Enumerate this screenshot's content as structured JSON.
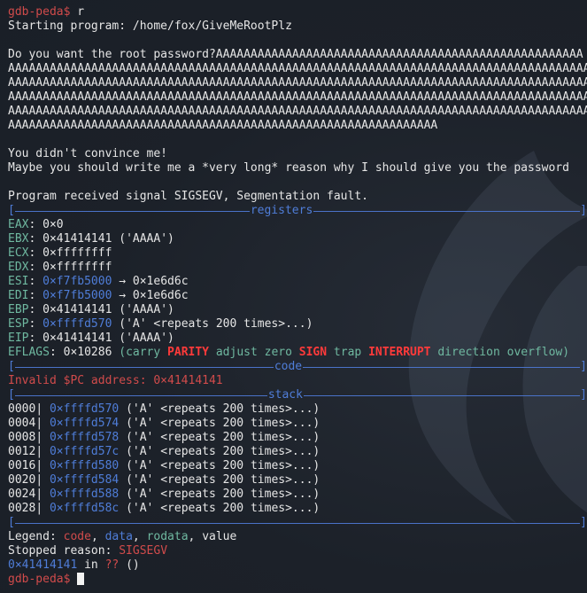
{
  "prompt": "gdb-peda$ ",
  "command": "r",
  "starting": "Starting program: /home/fox/GiveMeRootPlz",
  "input_line1": "Do you want the root password?AAAAAAAAAAAAAAAAAAAAAAAAAAAAAAAAAAAAAAAAAAAAAAAAAAAAA",
  "input_lines": [
    "AAAAAAAAAAAAAAAAAAAAAAAAAAAAAAAAAAAAAAAAAAAAAAAAAAAAAAAAAAAAAAAAAAAAAAAAAAAAAAAAAAAAA",
    "AAAAAAAAAAAAAAAAAAAAAAAAAAAAAAAAAAAAAAAAAAAAAAAAAAAAAAAAAAAAAAAAAAAAAAAAAAAAAAAAAAAAA",
    "AAAAAAAAAAAAAAAAAAAAAAAAAAAAAAAAAAAAAAAAAAAAAAAAAAAAAAAAAAAAAAAAAAAAAAAAAAAAAAAAAAAAA",
    "AAAAAAAAAAAAAAAAAAAAAAAAAAAAAAAAAAAAAAAAAAAAAAAAAAAAAAAAAAAAAAAAAAAAAAAAAAAAAAAAAAAAA"
  ],
  "input_last": "AAAAAAAAAAAAAAAAAAAAAAAAAAAAAAAAAAAAAAAAAAAAAAAAAAAAAAAAAAAAAA",
  "msg1": "You didn't convince me!",
  "msg2": "Maybe you should write me a *very long* reason why I should give you the password",
  "signal": "Program received signal SIGSEGV, Segmentation fault.",
  "sections": {
    "registers": "registers",
    "code": "code",
    "stack": "stack"
  },
  "bracket_open": "[",
  "bracket_close": "]",
  "registers": {
    "eax": {
      "name": "EAX",
      "value": "0×0"
    },
    "ebx": {
      "name": "EBX",
      "value": "0×41414141",
      "extra": "('AAAA')"
    },
    "ecx": {
      "name": "ECX",
      "value": "0×ffffffff"
    },
    "edx": {
      "name": "EDX",
      "value": "0×ffffffff"
    },
    "esi": {
      "name": "ESI",
      "value": "0×f7fb5000",
      "arrow": "→",
      "deref": "0×1e6d6c"
    },
    "edi": {
      "name": "EDI",
      "value": "0×f7fb5000",
      "arrow": "→",
      "deref": "0×1e6d6c"
    },
    "ebp": {
      "name": "EBP",
      "value": "0×41414141",
      "extra": "('AAAA')"
    },
    "esp": {
      "name": "ESP",
      "value": "0×ffffd570",
      "extra": "('A' <repeats 200 times>...)"
    },
    "eip": {
      "name": "EIP",
      "value": "0×41414141",
      "extra": "('AAAA')"
    },
    "eflags": {
      "name": "EFLAGS",
      "value": "0×10286",
      "flags": [
        "carry",
        "PARITY",
        "adjust",
        "zero",
        "SIGN",
        "trap",
        "INTERRUPT",
        "direction",
        "overflow"
      ]
    }
  },
  "code_error": "Invalid $PC address: 0×41414141",
  "stack_rows": [
    {
      "off": "0000",
      "addr": "0×ffffd570",
      "val": "('A' <repeats 200 times>...)"
    },
    {
      "off": "0004",
      "addr": "0×ffffd574",
      "val": "('A' <repeats 200 times>...)"
    },
    {
      "off": "0008",
      "addr": "0×ffffd578",
      "val": "('A' <repeats 200 times>...)"
    },
    {
      "off": "0012",
      "addr": "0×ffffd57c",
      "val": "('A' <repeats 200 times>...)"
    },
    {
      "off": "0016",
      "addr": "0×ffffd580",
      "val": "('A' <repeats 200 times>...)"
    },
    {
      "off": "0020",
      "addr": "0×ffffd584",
      "val": "('A' <repeats 200 times>...)"
    },
    {
      "off": "0024",
      "addr": "0×ffffd588",
      "val": "('A' <repeats 200 times>...)"
    },
    {
      "off": "0028",
      "addr": "0×ffffd58c",
      "val": "('A' <repeats 200 times>...)"
    }
  ],
  "legend": {
    "label": "Legend: ",
    "code": "code",
    "data": "data",
    "rodata": "rodata",
    "value": "value",
    "comma": ", "
  },
  "stopped": {
    "label": "Stopped reason: ",
    "reason": "SIGSEGV"
  },
  "frame": {
    "addr": "0×41414141",
    "in": " in ",
    "func": "??",
    "args": " ()"
  },
  "colors": {
    "background": "#1c2129",
    "red": "#d14b4b",
    "blue": "#4f7dd8",
    "cyan": "#5aa6b8"
  }
}
